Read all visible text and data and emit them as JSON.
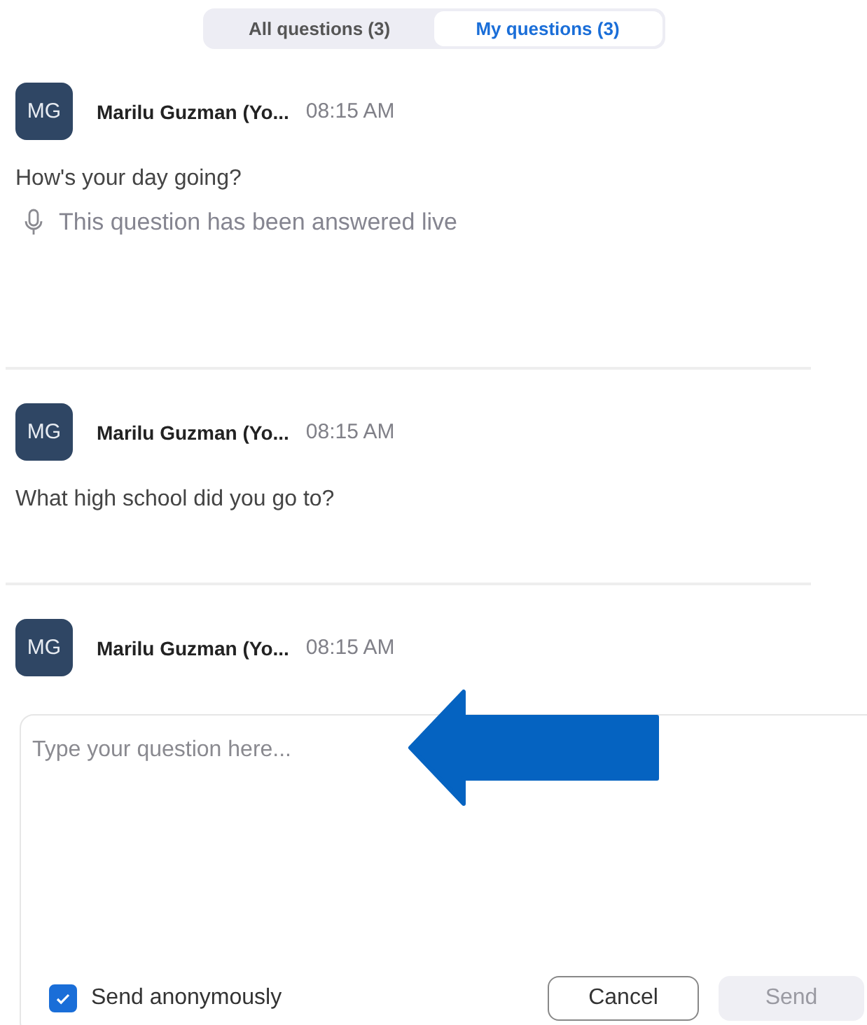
{
  "tabs": [
    {
      "label": "All questions (3)",
      "selected": false
    },
    {
      "label": "My questions (3)",
      "selected": true
    }
  ],
  "questions": [
    {
      "initials": "MG",
      "name": "Marilu Guzman (Yo...",
      "time": "08:15 AM",
      "text": "How's your day going?",
      "answered_live": true,
      "status": "This question has been answered live"
    },
    {
      "initials": "MG",
      "name": "Marilu Guzman (Yo...",
      "time": "08:15 AM",
      "text": "What high school did you go to?",
      "answered_live": false
    },
    {
      "initials": "MG",
      "name": "Marilu Guzman (Yo...",
      "time": "08:15 AM",
      "answered_live": false
    }
  ],
  "composer": {
    "placeholder": "Type your question here...",
    "anonymous": {
      "label": "Send anonymously",
      "checked": true
    },
    "buttons": [
      {
        "label": "Cancel",
        "disabled": false
      },
      {
        "label": "Send",
        "disabled": true
      }
    ]
  }
}
